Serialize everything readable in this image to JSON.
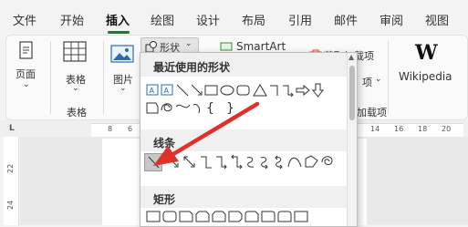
{
  "tabs": [
    "文件",
    "开始",
    "插入",
    "绘图",
    "设计",
    "布局",
    "引用",
    "邮件",
    "审阅",
    "视图"
  ],
  "ribbon": {
    "page_label": "页面",
    "table_label": "表格",
    "table_group": "表格",
    "picture_label": "图片",
    "shapes_button": "形状",
    "smartart_label": "SmartArt",
    "get_addins_label": "获取加载项",
    "addins_partial": "项",
    "addins_group_partial": "加载项",
    "wikipedia_label": "Wikipedia"
  },
  "ruler": {
    "left_ticks": [
      "8",
      "6"
    ],
    "right_ticks": [
      "14",
      "16",
      "18",
      "20"
    ],
    "vertical_ticks": [
      "22",
      "24"
    ],
    "corner": "L"
  },
  "shapes_panel": {
    "recent_title": "最近使用的形状",
    "lines_title": "线条",
    "rect_title": "矩形"
  },
  "annotation": {
    "arrow_color": "#e0302a"
  },
  "colors": {
    "accent": "#2f6d3f",
    "highlight": "#c7c7c7"
  }
}
